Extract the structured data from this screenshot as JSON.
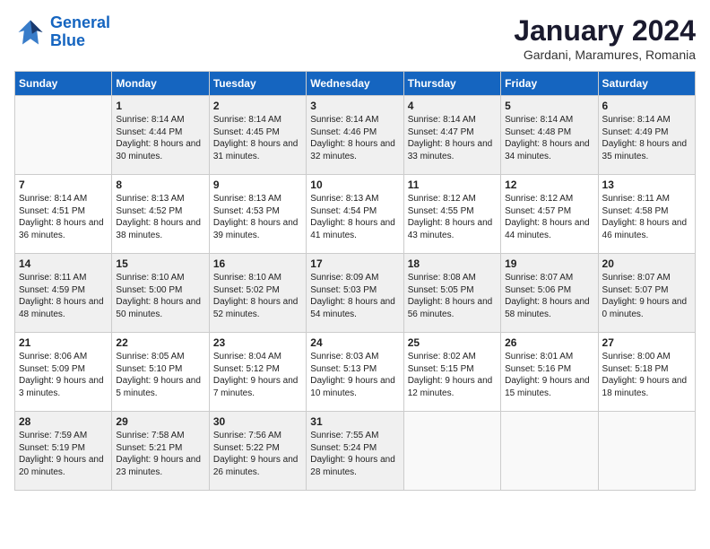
{
  "logo": {
    "line1": "General",
    "line2": "Blue"
  },
  "title": "January 2024",
  "location": "Gardani, Maramures, Romania",
  "weekdays": [
    "Sunday",
    "Monday",
    "Tuesday",
    "Wednesday",
    "Thursday",
    "Friday",
    "Saturday"
  ],
  "weeks": [
    [
      {
        "day": "",
        "sunrise": "",
        "sunset": "",
        "daylight": ""
      },
      {
        "day": "1",
        "sunrise": "Sunrise: 8:14 AM",
        "sunset": "Sunset: 4:44 PM",
        "daylight": "Daylight: 8 hours and 30 minutes."
      },
      {
        "day": "2",
        "sunrise": "Sunrise: 8:14 AM",
        "sunset": "Sunset: 4:45 PM",
        "daylight": "Daylight: 8 hours and 31 minutes."
      },
      {
        "day": "3",
        "sunrise": "Sunrise: 8:14 AM",
        "sunset": "Sunset: 4:46 PM",
        "daylight": "Daylight: 8 hours and 32 minutes."
      },
      {
        "day": "4",
        "sunrise": "Sunrise: 8:14 AM",
        "sunset": "Sunset: 4:47 PM",
        "daylight": "Daylight: 8 hours and 33 minutes."
      },
      {
        "day": "5",
        "sunrise": "Sunrise: 8:14 AM",
        "sunset": "Sunset: 4:48 PM",
        "daylight": "Daylight: 8 hours and 34 minutes."
      },
      {
        "day": "6",
        "sunrise": "Sunrise: 8:14 AM",
        "sunset": "Sunset: 4:49 PM",
        "daylight": "Daylight: 8 hours and 35 minutes."
      }
    ],
    [
      {
        "day": "7",
        "sunrise": "Sunrise: 8:14 AM",
        "sunset": "Sunset: 4:51 PM",
        "daylight": "Daylight: 8 hours and 36 minutes."
      },
      {
        "day": "8",
        "sunrise": "Sunrise: 8:13 AM",
        "sunset": "Sunset: 4:52 PM",
        "daylight": "Daylight: 8 hours and 38 minutes."
      },
      {
        "day": "9",
        "sunrise": "Sunrise: 8:13 AM",
        "sunset": "Sunset: 4:53 PM",
        "daylight": "Daylight: 8 hours and 39 minutes."
      },
      {
        "day": "10",
        "sunrise": "Sunrise: 8:13 AM",
        "sunset": "Sunset: 4:54 PM",
        "daylight": "Daylight: 8 hours and 41 minutes."
      },
      {
        "day": "11",
        "sunrise": "Sunrise: 8:12 AM",
        "sunset": "Sunset: 4:55 PM",
        "daylight": "Daylight: 8 hours and 43 minutes."
      },
      {
        "day": "12",
        "sunrise": "Sunrise: 8:12 AM",
        "sunset": "Sunset: 4:57 PM",
        "daylight": "Daylight: 8 hours and 44 minutes."
      },
      {
        "day": "13",
        "sunrise": "Sunrise: 8:11 AM",
        "sunset": "Sunset: 4:58 PM",
        "daylight": "Daylight: 8 hours and 46 minutes."
      }
    ],
    [
      {
        "day": "14",
        "sunrise": "Sunrise: 8:11 AM",
        "sunset": "Sunset: 4:59 PM",
        "daylight": "Daylight: 8 hours and 48 minutes."
      },
      {
        "day": "15",
        "sunrise": "Sunrise: 8:10 AM",
        "sunset": "Sunset: 5:00 PM",
        "daylight": "Daylight: 8 hours and 50 minutes."
      },
      {
        "day": "16",
        "sunrise": "Sunrise: 8:10 AM",
        "sunset": "Sunset: 5:02 PM",
        "daylight": "Daylight: 8 hours and 52 minutes."
      },
      {
        "day": "17",
        "sunrise": "Sunrise: 8:09 AM",
        "sunset": "Sunset: 5:03 PM",
        "daylight": "Daylight: 8 hours and 54 minutes."
      },
      {
        "day": "18",
        "sunrise": "Sunrise: 8:08 AM",
        "sunset": "Sunset: 5:05 PM",
        "daylight": "Daylight: 8 hours and 56 minutes."
      },
      {
        "day": "19",
        "sunrise": "Sunrise: 8:07 AM",
        "sunset": "Sunset: 5:06 PM",
        "daylight": "Daylight: 8 hours and 58 minutes."
      },
      {
        "day": "20",
        "sunrise": "Sunrise: 8:07 AM",
        "sunset": "Sunset: 5:07 PM",
        "daylight": "Daylight: 9 hours and 0 minutes."
      }
    ],
    [
      {
        "day": "21",
        "sunrise": "Sunrise: 8:06 AM",
        "sunset": "Sunset: 5:09 PM",
        "daylight": "Daylight: 9 hours and 3 minutes."
      },
      {
        "day": "22",
        "sunrise": "Sunrise: 8:05 AM",
        "sunset": "Sunset: 5:10 PM",
        "daylight": "Daylight: 9 hours and 5 minutes."
      },
      {
        "day": "23",
        "sunrise": "Sunrise: 8:04 AM",
        "sunset": "Sunset: 5:12 PM",
        "daylight": "Daylight: 9 hours and 7 minutes."
      },
      {
        "day": "24",
        "sunrise": "Sunrise: 8:03 AM",
        "sunset": "Sunset: 5:13 PM",
        "daylight": "Daylight: 9 hours and 10 minutes."
      },
      {
        "day": "25",
        "sunrise": "Sunrise: 8:02 AM",
        "sunset": "Sunset: 5:15 PM",
        "daylight": "Daylight: 9 hours and 12 minutes."
      },
      {
        "day": "26",
        "sunrise": "Sunrise: 8:01 AM",
        "sunset": "Sunset: 5:16 PM",
        "daylight": "Daylight: 9 hours and 15 minutes."
      },
      {
        "day": "27",
        "sunrise": "Sunrise: 8:00 AM",
        "sunset": "Sunset: 5:18 PM",
        "daylight": "Daylight: 9 hours and 18 minutes."
      }
    ],
    [
      {
        "day": "28",
        "sunrise": "Sunrise: 7:59 AM",
        "sunset": "Sunset: 5:19 PM",
        "daylight": "Daylight: 9 hours and 20 minutes."
      },
      {
        "day": "29",
        "sunrise": "Sunrise: 7:58 AM",
        "sunset": "Sunset: 5:21 PM",
        "daylight": "Daylight: 9 hours and 23 minutes."
      },
      {
        "day": "30",
        "sunrise": "Sunrise: 7:56 AM",
        "sunset": "Sunset: 5:22 PM",
        "daylight": "Daylight: 9 hours and 26 minutes."
      },
      {
        "day": "31",
        "sunrise": "Sunrise: 7:55 AM",
        "sunset": "Sunset: 5:24 PM",
        "daylight": "Daylight: 9 hours and 28 minutes."
      },
      {
        "day": "",
        "sunrise": "",
        "sunset": "",
        "daylight": ""
      },
      {
        "day": "",
        "sunrise": "",
        "sunset": "",
        "daylight": ""
      },
      {
        "day": "",
        "sunrise": "",
        "sunset": "",
        "daylight": ""
      }
    ]
  ]
}
